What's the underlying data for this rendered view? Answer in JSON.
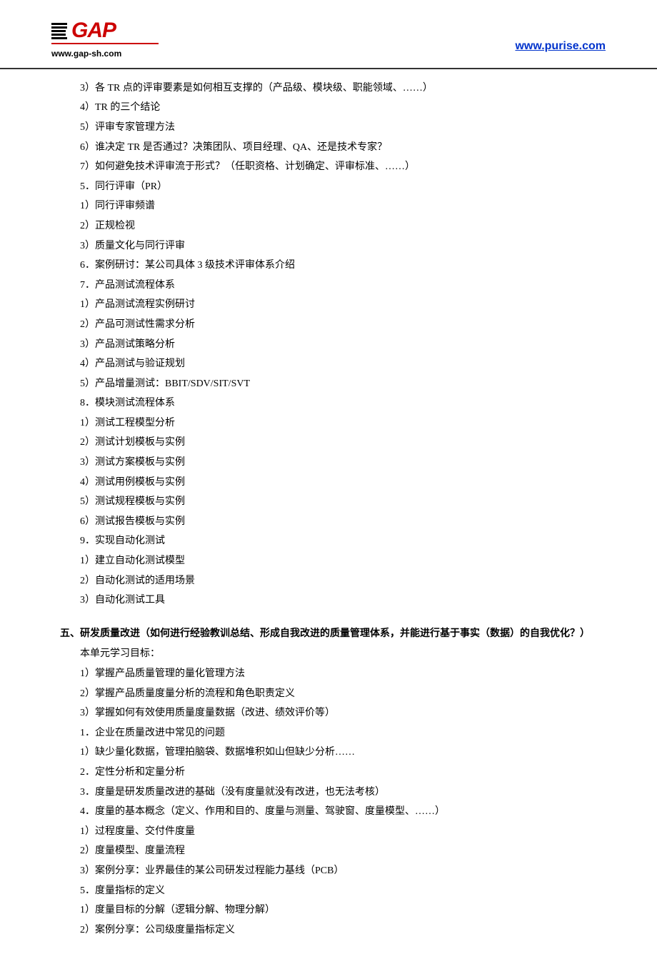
{
  "header": {
    "logo_text": "GAP",
    "logo_url": "www.gap-sh.com",
    "right_url": "www.purise.com"
  },
  "content": {
    "block1": [
      "3）各 TR 点的评审要素是如何相互支撑的（产品级、模块级、职能领域、……）",
      "4）TR 的三个结论",
      "5）评审专家管理方法",
      "6）谁决定 TR 是否通过？决策团队、项目经理、QA、还是技术专家？",
      "7）如何避免技术评审流于形式？（任职资格、计划确定、评审标准、……）",
      "5．同行评审（PR）",
      "1）同行评审频谱",
      "2）正规检视",
      "3）质量文化与同行评审",
      "6．案例研讨：某公司具体 3 级技术评审体系介绍",
      "7．产品测试流程体系",
      "1）产品测试流程实例研讨",
      "2）产品可测试性需求分析",
      "3）产品测试策略分析",
      "4）产品测试与验证规划",
      "5）产品增量测试：BBIT/SDV/SIT/SVT",
      "8．模块测试流程体系",
      "1）测试工程模型分析",
      "2）测试计划模板与实例",
      "3）测试方案模板与实例",
      "4）测试用例模板与实例",
      "5）测试规程模板与实例",
      "6）测试报告模板与实例",
      "9．实现自动化测试",
      "1）建立自动化测试模型",
      "2）自动化测试的适用场景",
      "3）自动化测试工具"
    ],
    "heading": "五、研发质量改进（如何进行经验教训总结、形成自我改进的质量管理体系，并能进行基于事实（数据）的自我优化？）",
    "block2": [
      "本单元学习目标：",
      "1）掌握产品质量管理的量化管理方法",
      "2）掌握产品质量度量分析的流程和角色职责定义",
      "3）掌握如何有效使用质量度量数据（改进、绩效评价等）",
      "1．企业在质量改进中常见的问题",
      "1）缺少量化数据，管理拍脑袋、数据堆积如山但缺少分析……",
      "2．定性分析和定量分析",
      "3．度量是研发质量改进的基础（没有度量就没有改进，也无法考核）",
      "4．度量的基本概念（定义、作用和目的、度量与测量、驾驶窗、度量模型、……）",
      "1）过程度量、交付件度量",
      "2）度量模型、度量流程",
      "3）案例分享：业界最佳的某公司研发过程能力基线（PCB）",
      "5．度量指标的定义",
      "1）度量目标的分解（逻辑分解、物理分解）",
      "2）案例分享：公司级度量指标定义"
    ]
  }
}
